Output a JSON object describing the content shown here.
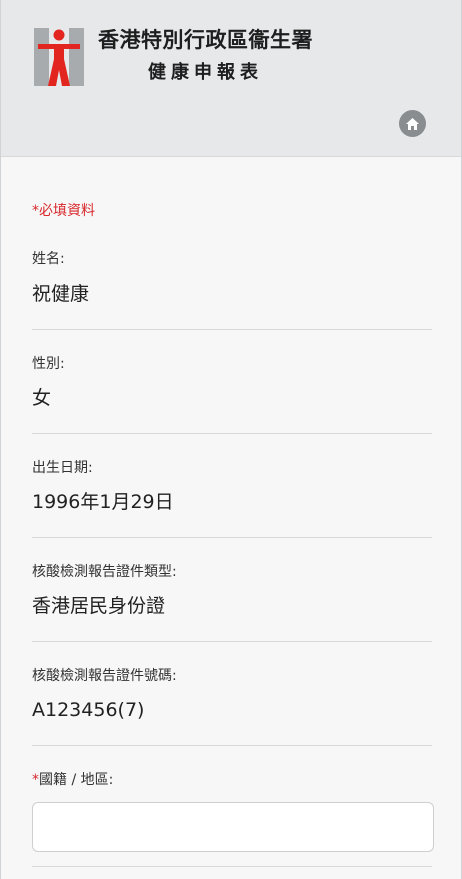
{
  "header": {
    "org_name": "香港特別行政區衞生署",
    "form_title": "健康申報表",
    "home_icon": "home-icon",
    "logo_icon": "department-of-health-logo"
  },
  "form": {
    "required_note": "*必填資料",
    "fields": [
      {
        "label": "姓名:",
        "value": "祝健康"
      },
      {
        "label": "性別:",
        "value": "女"
      },
      {
        "label": "出生日期:",
        "value": "1996年1月29日"
      },
      {
        "label": "核酸檢測報告證件類型:",
        "value": "香港居民身份證"
      },
      {
        "label": "核酸檢測報告證件號碼:",
        "value": "A123456(7)"
      }
    ],
    "nationality": {
      "required_mark": "*",
      "label": "國籍 / 地區:",
      "value": ""
    }
  },
  "colors": {
    "required_red": "#d8282c",
    "header_bg": "#e6e8ea",
    "logo_red": "#e3251f",
    "logo_gray": "#a8abad"
  }
}
